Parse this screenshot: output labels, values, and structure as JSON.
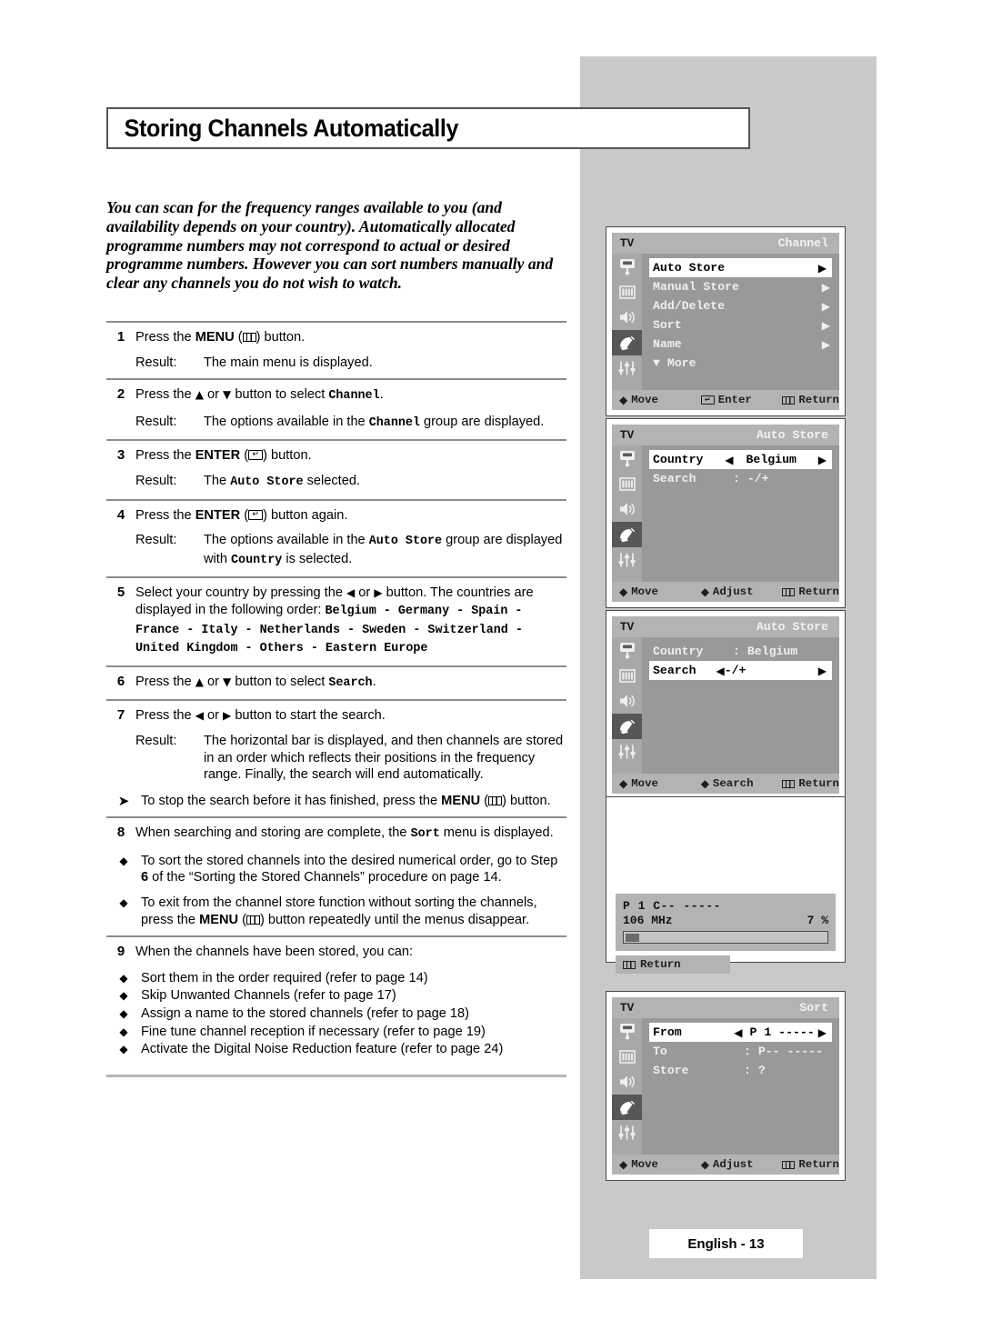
{
  "page": {
    "title": "Storing Channels Automatically",
    "footer": "English - 13",
    "intro": "You can scan for the frequency ranges available to you (and availability depends on your country). Automatically allocated programme numbers may not correspond to actual or desired programme numbers. However you can sort numbers manually and clear any channels you do not wish to watch."
  },
  "steps": {
    "s1": {
      "num": "1",
      "text_a": "Press the ",
      "bold": "MENU",
      "text_b": " (",
      "text_c": ") button.",
      "result_label": "Result:",
      "result": "The main menu is displayed."
    },
    "s2": {
      "num": "2",
      "text_a": "Press the ",
      "up": "▲",
      "or": " or ",
      "down": "▼",
      "text_b": " button to select ",
      "mono": "Channel",
      "text_c": ".",
      "result_label": "Result:",
      "result_a": "The options available in the ",
      "result_mono": "Channel",
      "result_b": " group are displayed."
    },
    "s3": {
      "num": "3",
      "text_a": "Press the ",
      "bold": "ENTER",
      "text_b": " (",
      "text_c": ") button.",
      "result_label": "Result:",
      "result_a": "The ",
      "result_mono": "Auto Store",
      "result_b": " selected."
    },
    "s4": {
      "num": "4",
      "text_a": "Press the ",
      "bold": "ENTER",
      "text_b": " (",
      "text_c": ") button again.",
      "result_label": "Result:",
      "result_a": "The options available in the ",
      "result_mono": "Auto Store",
      "result_b": " group are displayed with ",
      "result_mono2": "Country",
      "result_c": " is selected."
    },
    "s5": {
      "num": "5",
      "text_a": "Select your country by pressing the ",
      "left": "◀",
      "or": " or ",
      "right": "▶",
      "text_b": " button. The countries are displayed in the following order: ",
      "countries": "Belgium - Germany - Spain - France - Italy - Netherlands - Sweden - Switzerland - United Kingdom - Others - Eastern Europe"
    },
    "s6": {
      "num": "6",
      "text_a": "Press the ",
      "up": "▲",
      "or": " or ",
      "down": "▼",
      "text_b": " button to select ",
      "mono": "Search",
      "text_c": "."
    },
    "s7": {
      "num": "7",
      "text_a": "Press the ",
      "left": "◀",
      "or": " or ",
      "right": "▶",
      "text_b": " button to start the search.",
      "result_label": "Result:",
      "result": "The horizontal bar is displayed, and then channels are stored in an order which reflects their positions in the frequency range. Finally, the search will end automatically.",
      "note_a": "To stop the search before it has finished, press the ",
      "note_bold": "MENU",
      "note_b": " (",
      "note_c": ") button."
    },
    "s8": {
      "num": "8",
      "text_a": "When searching and storing are complete, the ",
      "mono": "Sort",
      "text_b": " menu is displayed.",
      "bullets": [
        {
          "a": "To sort the stored channels into the desired numerical order, go to Step ",
          "b": "6",
          "c": " of the “Sorting the Stored Channels” procedure on page 14."
        },
        {
          "a": "To exit from the channel store function without sorting the channels, press the ",
          "bold": "MENU",
          "mid": " (",
          "c": ") button repeatedly until the menus disappear."
        }
      ]
    },
    "s9": {
      "num": "9",
      "text": "When the channels have been stored, you can:",
      "bullets": [
        "Sort them in the order required (refer to page 14)",
        "Skip Unwanted Channels (refer to page 17)",
        "Assign a name to the stored channels (refer to page 18)",
        "Fine tune channel reception if necessary (refer to page 19)",
        "Activate the Digital Noise Reduction feature (refer to page 24)"
      ]
    }
  },
  "osd": {
    "tv_tag": "TV",
    "rail_icons": [
      "picture-icon",
      "screen-icon",
      "speaker-icon",
      "satellite-dish-icon",
      "setup-sliders-icon"
    ],
    "menu1": {
      "title": "Channel",
      "rows": [
        {
          "label": "Auto Store",
          "arrow": "▶",
          "selected": true
        },
        {
          "label": "Manual Store",
          "arrow": "▶",
          "selected": false
        },
        {
          "label": "Add/Delete",
          "arrow": "▶",
          "selected": false
        },
        {
          "label": "Sort",
          "arrow": "▶",
          "selected": false
        },
        {
          "label": "Name",
          "arrow": "▶",
          "selected": false
        },
        {
          "label": "▼ More",
          "arrow": "",
          "selected": false
        }
      ],
      "foot": {
        "move": "Move",
        "center": "Enter",
        "return": "Return"
      }
    },
    "menu2": {
      "title": "Auto Store",
      "rows": [
        {
          "label": "Country",
          "left": "◀",
          "value": "Belgium",
          "arrow": "▶",
          "selected": true
        },
        {
          "label": "Search",
          "value": ":  -/+",
          "selected": false
        }
      ],
      "foot": {
        "move": "Move",
        "center": "Adjust",
        "return": "Return"
      }
    },
    "menu3": {
      "title": "Auto Store",
      "rows": [
        {
          "label": "Country",
          "value": ":  Belgium",
          "selected": false
        },
        {
          "label": "Search",
          "left": "◀",
          "value": "-/+",
          "arrow": "▶",
          "selected": true
        }
      ],
      "foot": {
        "move": "Move",
        "center": "Search",
        "return": "Return"
      }
    },
    "search": {
      "line1": "P  1  C--  -----",
      "freq": "106 MHz",
      "percent": "7 %",
      "progress": 7,
      "return": "Return"
    },
    "menu5": {
      "title": "Sort",
      "rows": [
        {
          "label": "From",
          "left": "◀",
          "value": "P 1 -----",
          "arrow": "▶",
          "selected": true
        },
        {
          "label": "To",
          "value": ":  P--  -----",
          "selected": false
        },
        {
          "label": "Store",
          "value": ":  ?",
          "selected": false
        }
      ],
      "foot": {
        "move": "Move",
        "center": "Adjust",
        "return": "Return"
      }
    }
  }
}
